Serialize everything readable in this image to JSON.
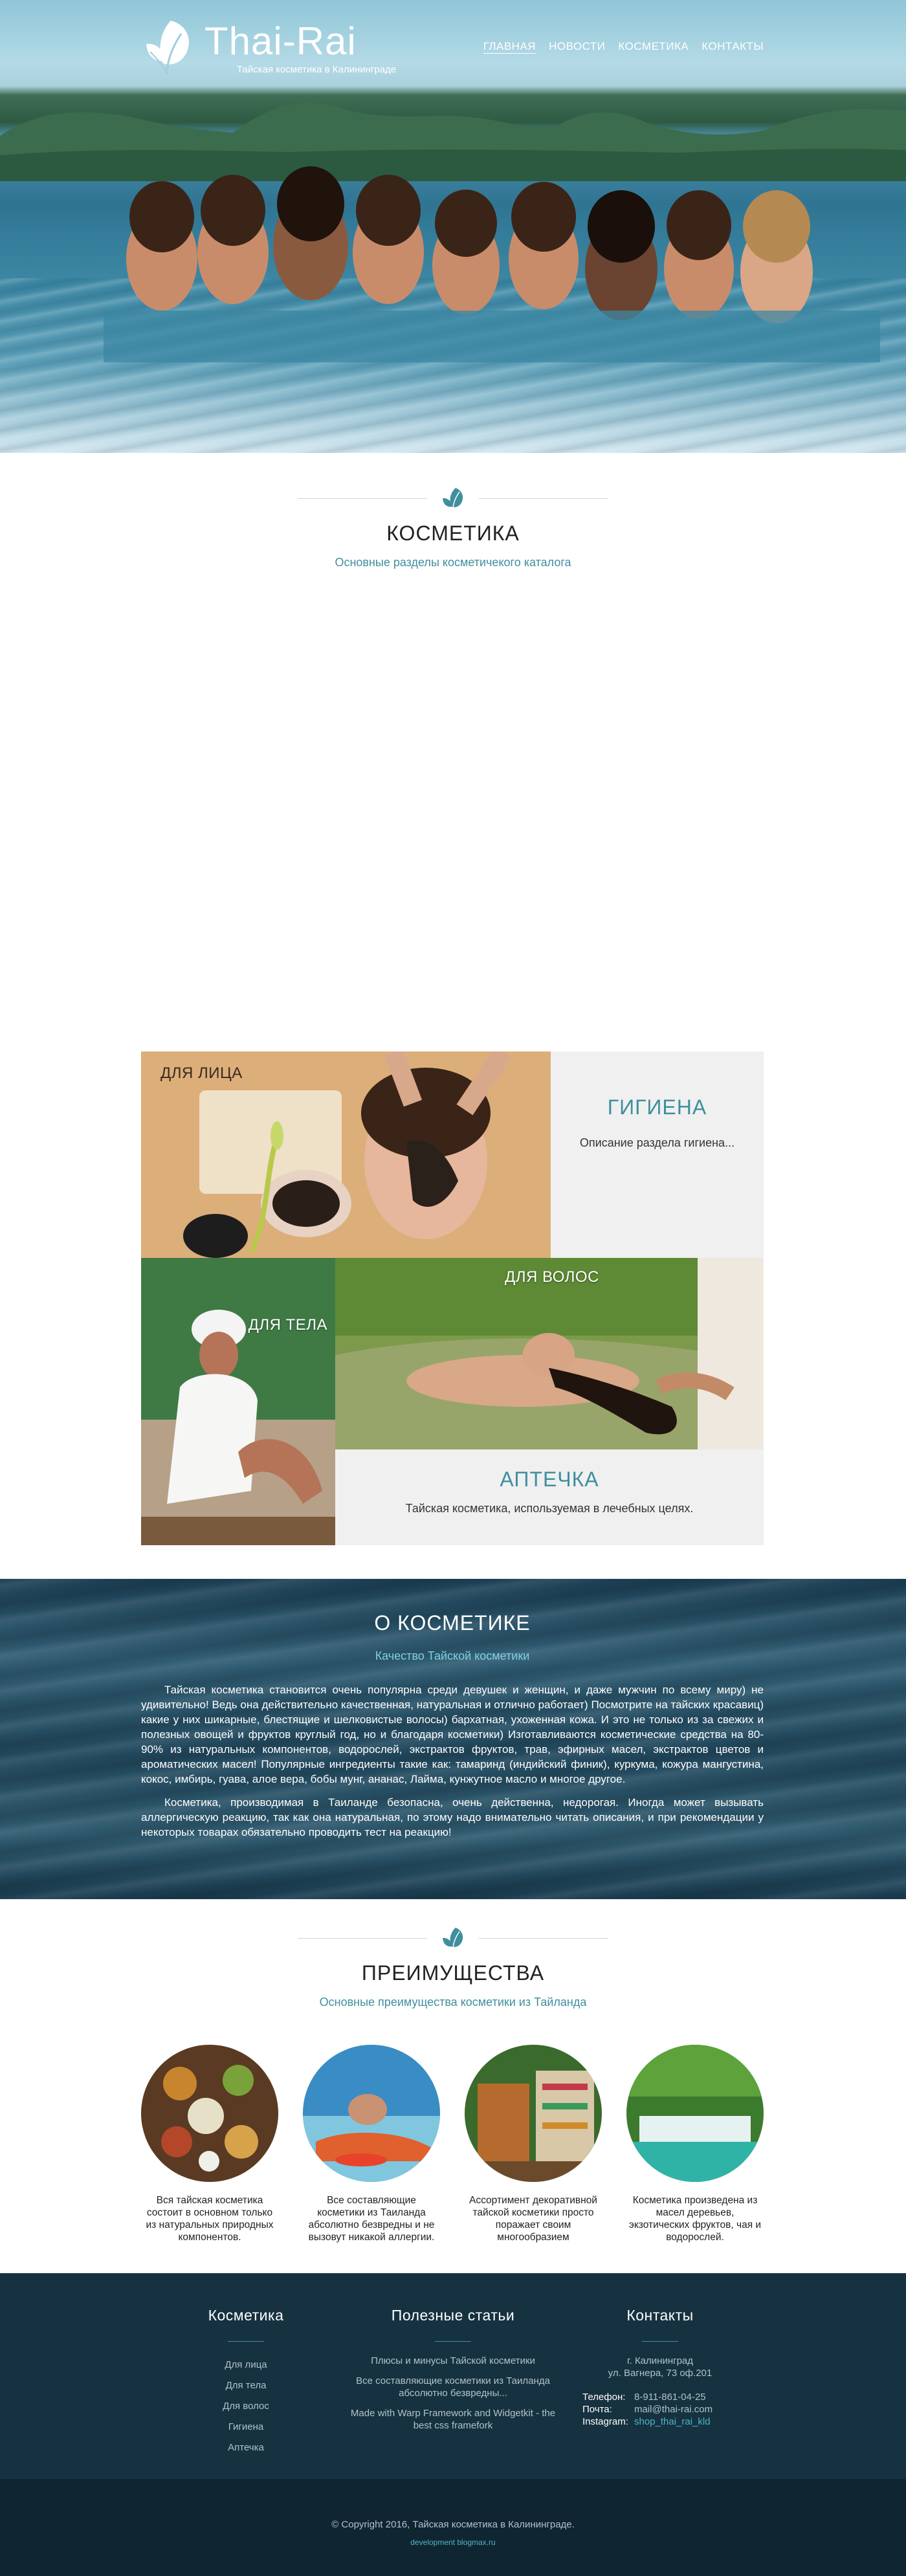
{
  "brand": {
    "title": "Thai-Rai",
    "subtitle": "Тайская косметика в Калининграде"
  },
  "nav": [
    {
      "label": "Главная",
      "active": true
    },
    {
      "label": "Новости"
    },
    {
      "label": "Косметика"
    },
    {
      "label": "Контакты"
    }
  ],
  "cosmetics": {
    "title": "КОСМЕТИКА",
    "subtitle": "Основные разделы косметичекого каталога",
    "tiles": {
      "face": "ДЛЯ ЛИЦА",
      "hygiene": {
        "title": "ГИГИЕНА",
        "desc": "Описание раздела гигиена..."
      },
      "body": "ДЛЯ ТЕЛА",
      "hair": "ДЛЯ ВОЛОС",
      "pharmacy": {
        "title": "АПТЕЧКА",
        "desc": "Тайская косметика, используемая в лечебных целях."
      }
    }
  },
  "about": {
    "title": "О КОСМЕТИКЕ",
    "subtitle": "Качество Тайской косметики",
    "p1": "Тайская косметика становится очень популярна среди девушек и женщин, и даже мужчин по всему миру) не удивительно! Ведь она действительно качественная, натуральная и отлично работает) Посмотрите на тайских красавиц) какие у них шикарные, блестящие и шелковистые волосы) бархатная, ухоженная кожа. И это не только из за свежих и полезных овощей и фруктов круглый год, но и благодаря косметики) Изготавливаются косметические средства на 80-90% из натуральных компонентов, водорослей, экстрактов фруктов, трав, эфирных масел, экстрактов цветов и ароматических масел! Популярные ингредиенты такие как: тамаринд (индийский финик), куркума, кожура мангустина, кокос, имбирь, гуава, алое вера, бобы мунг, ананас, Лайма, кунжутное масло и многое другое.",
    "p2": "Косметика, производимая в Таиланде безопасна, очень действенна, недорогая. Иногда может вызывать аллергическую реакцию, так как она натуральная, по этому надо внимательно читать описания, и при рекомендации у некоторых товарах обязательно проводить тест на реакцию!"
  },
  "advantages": {
    "title": "ПРЕИМУЩЕСТВА",
    "subtitle": "Основные преимущества косметики из Тайланда",
    "items": [
      "Вся тайская косметика состоит в основном только из натуральных природных компонентов.",
      "Все составляющие косметики из Таиланда абсолютно безвредны и не вызовут никакой аллергии.",
      "Ассортимент декоративной тайской косметики просто поражает своим многообразием",
      "Косметика произведена из масел деревьев, экзотических фруктов, чая и водорослей."
    ]
  },
  "footer": {
    "col1": {
      "title": "Косметика",
      "links": [
        "Для лица",
        "Для тела",
        "Для волос",
        "Гигиена",
        "Аптечка"
      ]
    },
    "col2": {
      "title": "Полезные статьи",
      "articles": [
        "Плюсы и минусы Тайской косметики",
        "Все составляющие косметики из Таиланда абсолютно безвредны...",
        "Made with Warp Framework and Widgetkit - the best css framefork"
      ]
    },
    "col3": {
      "title": "Контакты",
      "city": "г. Калининград",
      "street": "ул. Вагнера, 73 оф.201",
      "phone_k": "Телефон:",
      "phone_v": "8-911-861-04-25",
      "mail_k": "Почта:",
      "mail_v": "mail@thai-rai.com",
      "insta_k": "Instagram:",
      "insta_v": "shop_thai_rai_kld"
    },
    "copyright": "© Copyright 2016, Тайская косметика в Калининграде.",
    "dev": "development blogmax.ru"
  },
  "colors": {
    "accent": "#3f8f9e",
    "footer_bg": "#163240",
    "copy_bg": "#0f2632"
  },
  "icons": [
    "leaf-logo-icon",
    "leaf-divider-icon"
  ]
}
